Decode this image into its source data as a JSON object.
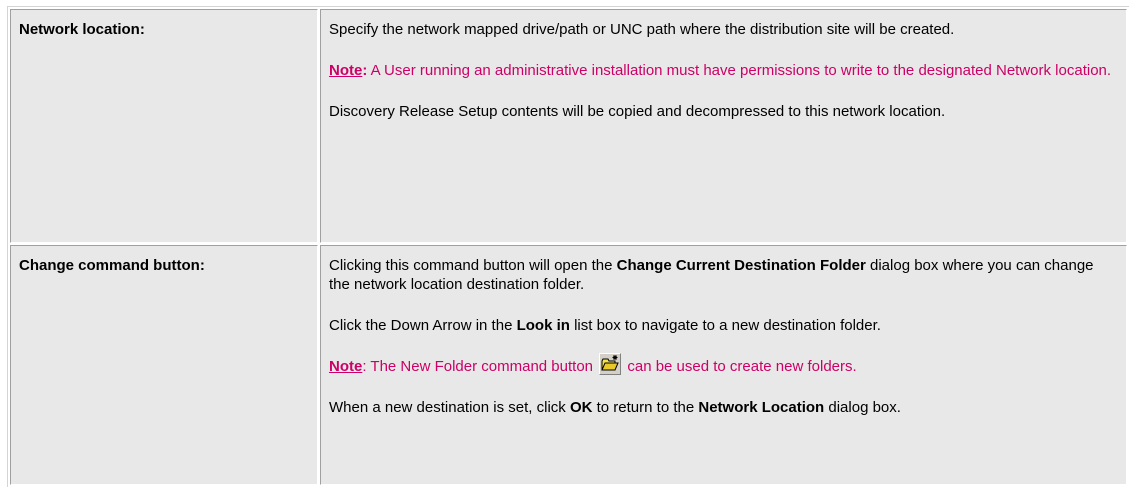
{
  "rows": [
    {
      "label": "Network location:",
      "p1": "Specify the network mapped drive/path or UNC path where the distribution site will be created.",
      "note_label": "Note",
      "note_colon": ":",
      "note_text": "  A User running an administrative installation must have permissions to write to the designated Network location.",
      "p3": "Discovery Release Setup contents will be copied and decompressed to this network location."
    },
    {
      "label": "Change command button:",
      "p1_a": "Clicking this command button will open the ",
      "p1_b": "Change Current Destination Folder",
      "p1_c": " dialog box where you can change the network location destination folder.",
      "p2_a": "Click the Down Arrow in the ",
      "p2_b": "Look in",
      "p2_c": " list box to navigate to a new destination folder.",
      "note_label": "Note",
      "note_a": ":  The New Folder command button ",
      "note_icon": "new-folder-icon",
      "note_b": " can be used to create new folders.",
      "p4_a": "When a new destination is set, click ",
      "p4_b": "OK",
      "p4_c": " to return to the ",
      "p4_d": "Network Location",
      "p4_e": " dialog box."
    }
  ],
  "colors": {
    "note": "#cc0066",
    "cell_bg": "#e8e8e8"
  }
}
